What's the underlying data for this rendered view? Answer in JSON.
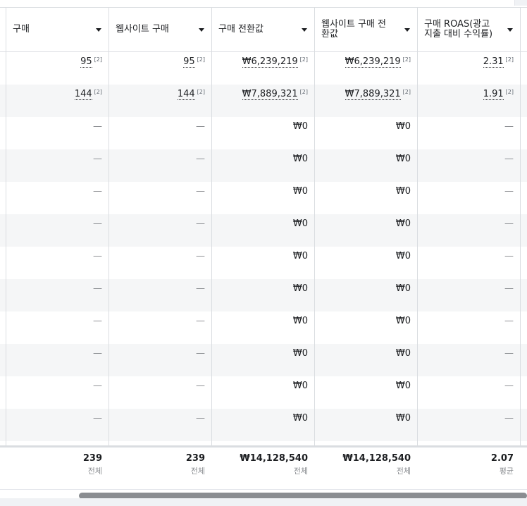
{
  "columns": [
    {
      "label": "구매"
    },
    {
      "label": "웹사이트 구매"
    },
    {
      "label": "구매 전환값"
    },
    {
      "label": "웹사이트 구매 전\n환값"
    },
    {
      "label": "구매 ROAS(광고\n지출 대비 수익률)"
    }
  ],
  "footnote": "[2]",
  "rows": [
    {
      "cells": [
        "95",
        "95",
        "₩6,239,219",
        "₩6,239,219",
        "2.31"
      ],
      "noted": true
    },
    {
      "cells": [
        "144",
        "144",
        "₩7,889,321",
        "₩7,889,321",
        "1.91"
      ],
      "noted": true
    },
    {
      "cells": [
        "—",
        "—",
        "₩0",
        "₩0",
        "—"
      ],
      "noted": false
    },
    {
      "cells": [
        "—",
        "—",
        "₩0",
        "₩0",
        "—"
      ],
      "noted": false
    },
    {
      "cells": [
        "—",
        "—",
        "₩0",
        "₩0",
        "—"
      ],
      "noted": false
    },
    {
      "cells": [
        "—",
        "—",
        "₩0",
        "₩0",
        "—"
      ],
      "noted": false
    },
    {
      "cells": [
        "—",
        "—",
        "₩0",
        "₩0",
        "—"
      ],
      "noted": false
    },
    {
      "cells": [
        "—",
        "—",
        "₩0",
        "₩0",
        "—"
      ],
      "noted": false
    },
    {
      "cells": [
        "—",
        "—",
        "₩0",
        "₩0",
        "—"
      ],
      "noted": false
    },
    {
      "cells": [
        "—",
        "—",
        "₩0",
        "₩0",
        "—"
      ],
      "noted": false
    },
    {
      "cells": [
        "—",
        "—",
        "₩0",
        "₩0",
        "—"
      ],
      "noted": false
    },
    {
      "cells": [
        "—",
        "—",
        "₩0",
        "₩0",
        "—"
      ],
      "noted": false
    }
  ],
  "summary": [
    {
      "value": "239",
      "label": "전체"
    },
    {
      "value": "239",
      "label": "전체"
    },
    {
      "value": "₩14,128,540",
      "label": "전체"
    },
    {
      "value": "₩14,128,540",
      "label": "전체"
    },
    {
      "value": "2.07",
      "label": "평균"
    }
  ]
}
